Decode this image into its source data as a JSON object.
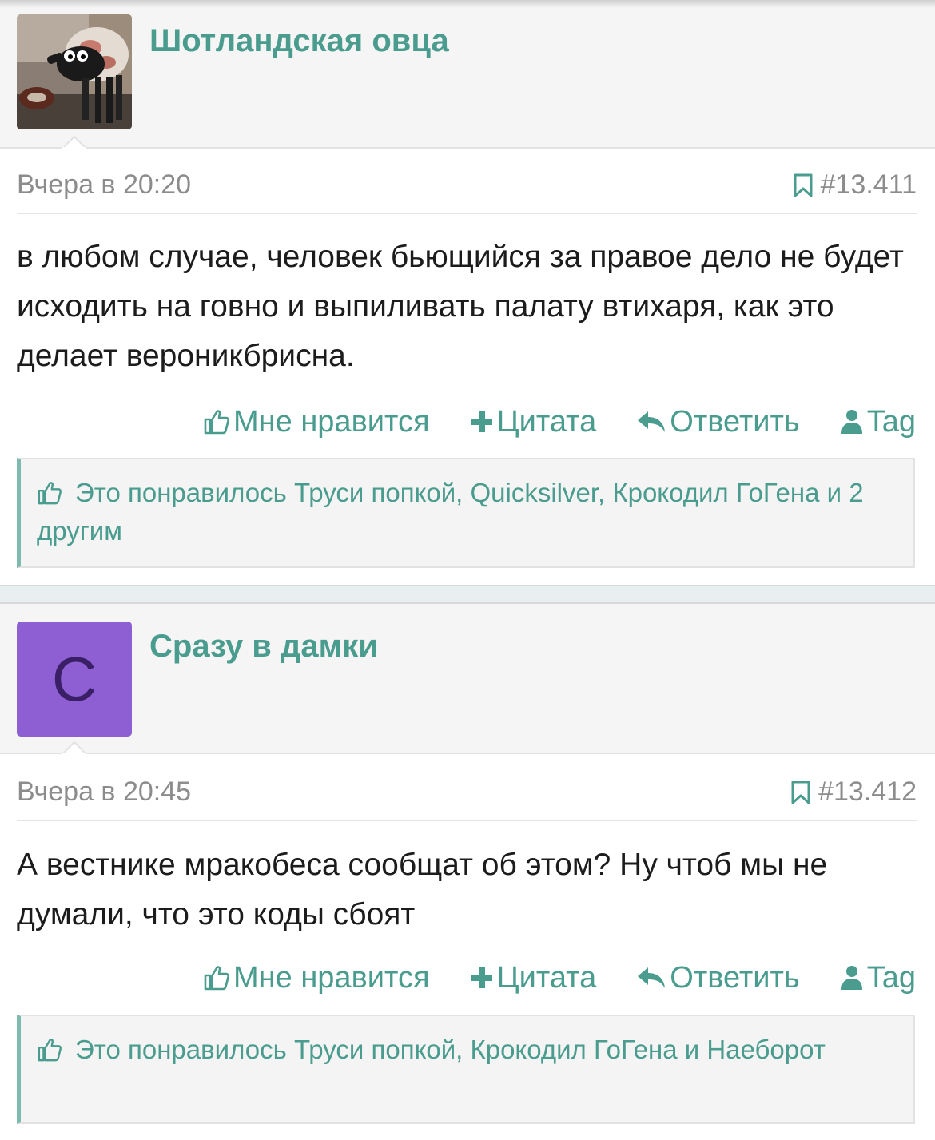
{
  "posts": [
    {
      "author": "Шотландская овца",
      "date": "Вчера в 20:20",
      "post_number": "#13.411",
      "message": "в любом случае, человек бьющийся за правое дело не будет исходить на говно и выпиливать палату втихаря, как это делает вероникбрисна.",
      "actions": {
        "like": "Мне нравится",
        "quote": "Цитата",
        "reply": "Ответить",
        "tag": "Tag"
      },
      "likes_prefix": "Это понравилось",
      "likes_users": "Труси попкой, Quicksilver, Крокодил ГоГена и 2 другим"
    },
    {
      "author": "Сразу в дамки",
      "avatar_letter": "С",
      "date": "Вчера в 20:45",
      "post_number": "#13.412",
      "message": "А вестнике мракобеса сообщат об этом? Ну чтоб мы не думали, что это коды сбоят",
      "actions": {
        "like": "Мне нравится",
        "quote": "Цитата",
        "reply": "Ответить",
        "tag": "Tag"
      },
      "likes_prefix": "Это понравилось",
      "likes_users": "Труси попкой, Крокодил ГоГена и Наеборот"
    }
  ],
  "colors": {
    "accent": "#4a9c8e",
    "avatar_purple": "#8d5fd3",
    "meta_gray": "#8c8c8c",
    "text": "#1c1c1c"
  },
  "icons": {
    "avatar_1": "sheep-avatar-image",
    "bookmark": "bookmark-icon",
    "like": "thumbs-up-icon",
    "quote": "plus-icon",
    "reply": "reply-arrow-icon",
    "tag": "user-icon"
  }
}
